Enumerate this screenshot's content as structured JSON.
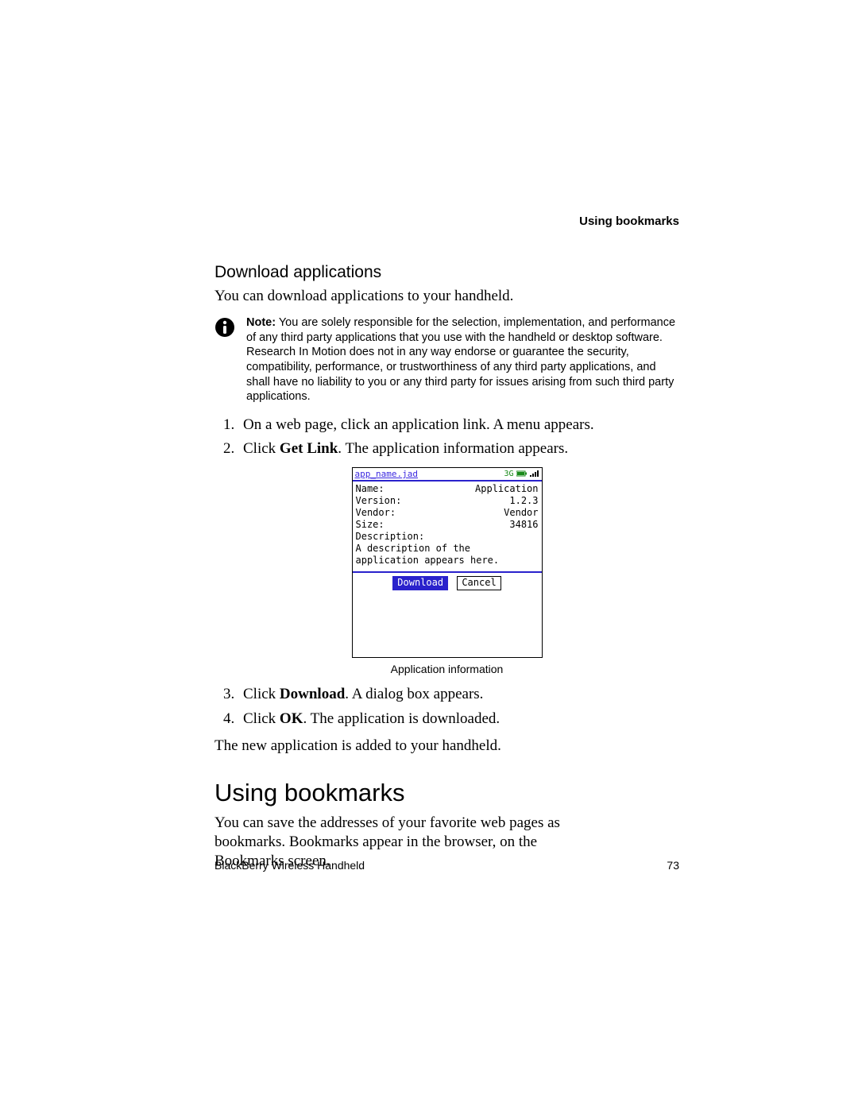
{
  "header": {
    "running_title": "Using bookmarks"
  },
  "download_apps": {
    "title": "Download applications",
    "intro": "You can download applications to your handheld.",
    "note_label": "Note:",
    "note_body": "You are solely responsible for the selection, implementation, and performance of any third party applications that you use with the handheld or desktop software. Research In Motion does not in any way endorse or guarantee the security, compatibility, performance, or trustworthiness of any third party applications, and shall have no liability to you or any third party for issues arising from such third party applications.",
    "steps": {
      "s1": "On a web page, click an application link. A menu appears.",
      "s2_pre": "Click ",
      "s2_bold": "Get Link",
      "s2_post": ". The application information appears.",
      "s3_pre": "Click ",
      "s3_bold": "Download",
      "s3_post": ". A dialog box appears.",
      "s4_pre": "Click ",
      "s4_bold": "OK",
      "s4_post": ". The application is downloaded."
    },
    "outro": "The new application is added to your handheld."
  },
  "device_screen": {
    "title_link": "app_name.jad",
    "status_text": "3G",
    "rows": {
      "name_label": "Name:",
      "name_value": "Application",
      "version_label": "Version:",
      "version_value": "1.2.3",
      "vendor_label": "Vendor:",
      "vendor_value": "Vendor",
      "size_label": "Size:",
      "size_value": "34816",
      "desc_label": "Description:"
    },
    "description_text": "A description of the application appears here.",
    "buttons": {
      "download": "Download",
      "cancel": "Cancel"
    },
    "caption": "Application information"
  },
  "bookmarks": {
    "title": "Using bookmarks",
    "body": "You can save the addresses of your favorite web pages as bookmarks. Bookmarks appear in the browser, on the Bookmarks screen."
  },
  "footer": {
    "product": "BlackBerry Wireless Handheld",
    "page_number": "73"
  }
}
